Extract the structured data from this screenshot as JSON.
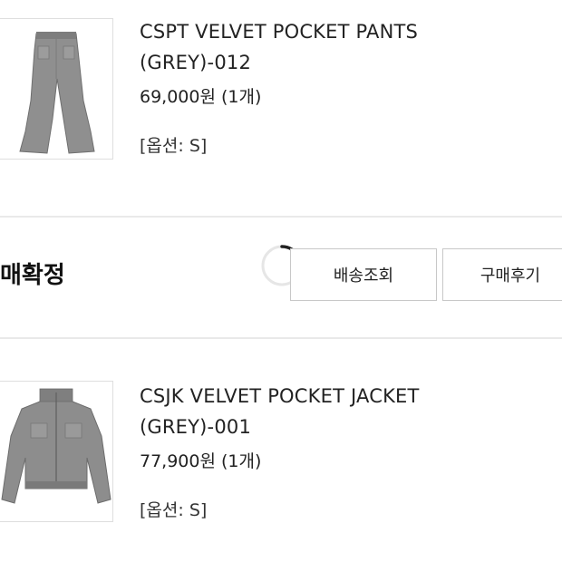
{
  "order_items": [
    {
      "name_line1": "CSPT VELVET POCKET PANTS",
      "name_line2": "(GREY)-012",
      "price": "69,000원 (1개)",
      "option": "[옵션: S]",
      "image_icon": "grey-velvet-pants"
    },
    {
      "name_line1": "CSJK VELVET POCKET JACKET",
      "name_line2": "(GREY)-001",
      "price": "77,900원 (1개)",
      "option": "[옵션: S]",
      "image_icon": "grey-velvet-jacket"
    }
  ],
  "order_status": {
    "label": "매확정",
    "track_button": "배송조회",
    "review_button": "구매후기"
  },
  "colors": {
    "divider": "#e9e9e9",
    "button_border": "#c8c8c8",
    "text": "#222222"
  }
}
